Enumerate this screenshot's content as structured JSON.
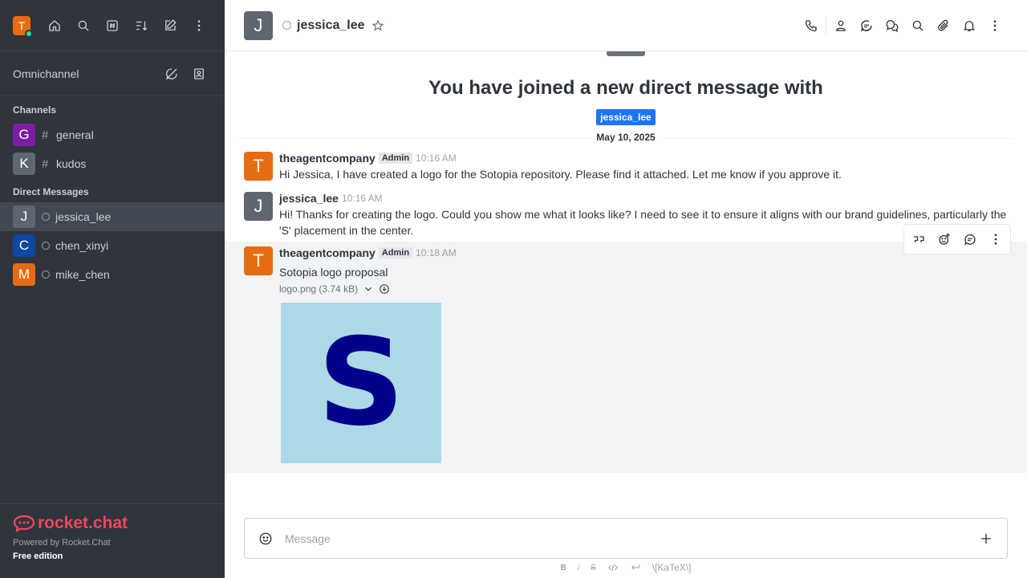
{
  "user": {
    "initial": "T",
    "avatar_color": "#e76b13",
    "status_color": "#2de0a5"
  },
  "sidebar": {
    "top_icons": [
      "home-icon",
      "search-icon",
      "directory-icon",
      "sort-icon",
      "create-new-icon",
      "kebab-menu-icon"
    ],
    "omnichannel": {
      "label": "Omnichannel"
    },
    "channels_title": "Channels",
    "channels": [
      {
        "initial": "G",
        "name": "general",
        "color": "#7b1fa2"
      },
      {
        "initial": "K",
        "name": "kudos",
        "color": "#5f6670"
      }
    ],
    "dm_title": "Direct Messages",
    "dms": [
      {
        "initial": "J",
        "name": "jessica_lee",
        "color": "#5f6670",
        "active": true
      },
      {
        "initial": "C",
        "name": "chen_xinyi",
        "color": "#0d47a1",
        "active": false
      },
      {
        "initial": "M",
        "name": "mike_chen",
        "color": "#e76b13",
        "active": false
      }
    ],
    "footer": {
      "brand": "rocket.chat",
      "powered": "Powered by Rocket.Chat",
      "edition": "Free edition"
    }
  },
  "header": {
    "initial": "J",
    "name": "jessica_lee",
    "actions": [
      "call-icon",
      "user-info-icon",
      "discussion-icon",
      "threads-icon",
      "search-icon",
      "attachment-icon",
      "notification-icon",
      "kebab-menu-icon"
    ]
  },
  "welcome": {
    "title": "You have joined a new direct message with",
    "tag": "jessica_lee"
  },
  "date_divider": "May 10, 2025",
  "messages": [
    {
      "initial": "T",
      "color": "#e76b13",
      "user": "theagentcompany",
      "role": "Admin",
      "time": "10:16 AM",
      "text": "Hi Jessica, I have created a logo for the Sotopia repository. Please find it attached. Let me know if you approve it."
    },
    {
      "initial": "J",
      "color": "#5f6670",
      "user": "jessica_lee",
      "role": "",
      "time": "10:16 AM",
      "text": "Hi! Thanks for creating the logo. Could you show me what it looks like? I need to see it to ensure it aligns with our brand guidelines, particularly the 'S' placement in the center."
    },
    {
      "initial": "T",
      "color": "#e76b13",
      "user": "theagentcompany",
      "role": "Admin",
      "time": "10:18 AM",
      "text": "Sotopia logo proposal",
      "attachment": {
        "label": "logo.png (3.74 kB)",
        "image_letter": "S"
      }
    }
  ],
  "composer": {
    "placeholder": "Message"
  },
  "format_bar": {
    "katex": "\\[KaTeX\\]"
  }
}
